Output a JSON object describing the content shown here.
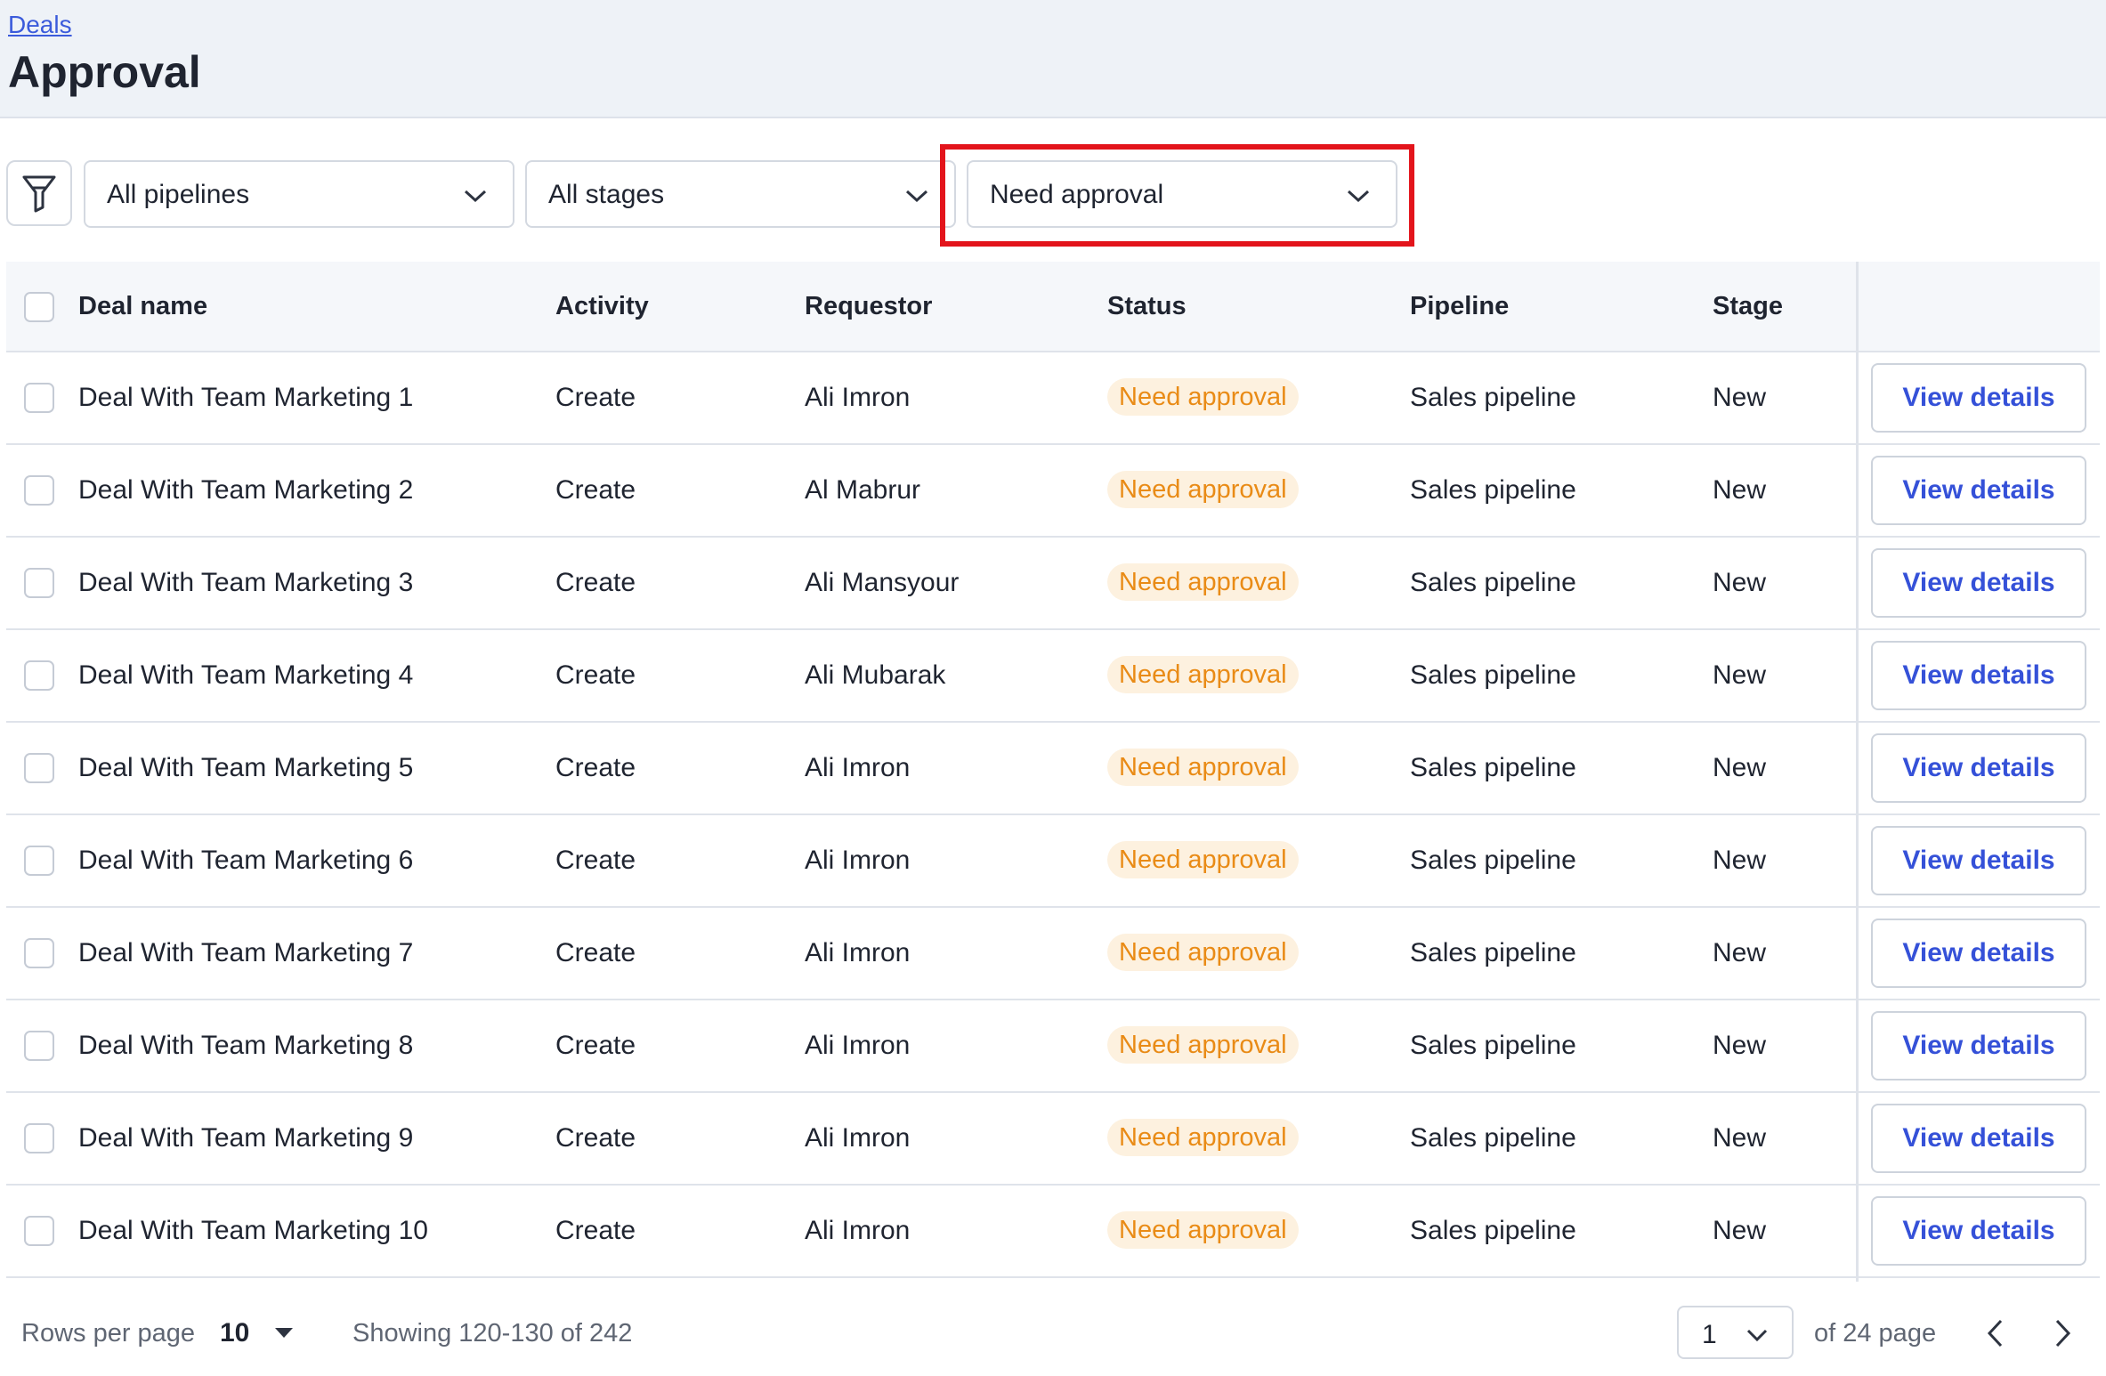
{
  "header": {
    "breadcrumb": "Deals",
    "title": "Approval"
  },
  "filters": {
    "filter_icon": "funnel-icon",
    "pipeline": "All pipelines",
    "stage": "All stages",
    "status": "Need approval"
  },
  "table": {
    "columns": {
      "deal_name": "Deal name",
      "activity": "Activity",
      "requestor": "Requestor",
      "status": "Status",
      "pipeline": "Pipeline",
      "stage": "Stage"
    },
    "rows": [
      {
        "deal_name": "Deal With Team Marketing 1",
        "activity": "Create",
        "requestor": "Ali Imron",
        "status": "Need approval",
        "pipeline": "Sales pipeline",
        "stage": "New",
        "action": "View details"
      },
      {
        "deal_name": "Deal With Team Marketing 2",
        "activity": "Create",
        "requestor": "Al Mabrur",
        "status": "Need approval",
        "pipeline": "Sales pipeline",
        "stage": "New",
        "action": "View details"
      },
      {
        "deal_name": "Deal With Team Marketing 3",
        "activity": "Create",
        "requestor": "Ali Mansyour",
        "status": "Need approval",
        "pipeline": "Sales pipeline",
        "stage": "New",
        "action": "View details"
      },
      {
        "deal_name": "Deal With Team Marketing 4",
        "activity": "Create",
        "requestor": "Ali Mubarak",
        "status": "Need approval",
        "pipeline": "Sales pipeline",
        "stage": "New",
        "action": "View details"
      },
      {
        "deal_name": "Deal With Team Marketing 5",
        "activity": "Create",
        "requestor": "Ali Imron",
        "status": "Need approval",
        "pipeline": "Sales pipeline",
        "stage": "New",
        "action": "View details"
      },
      {
        "deal_name": "Deal With Team Marketing 6",
        "activity": "Create",
        "requestor": "Ali Imron",
        "status": "Need approval",
        "pipeline": "Sales pipeline",
        "stage": "New",
        "action": "View details"
      },
      {
        "deal_name": "Deal With Team Marketing 7",
        "activity": "Create",
        "requestor": "Ali Imron",
        "status": "Need approval",
        "pipeline": "Sales pipeline",
        "stage": "New",
        "action": "View details"
      },
      {
        "deal_name": "Deal With Team Marketing 8",
        "activity": "Create",
        "requestor": "Ali Imron",
        "status": "Need approval",
        "pipeline": "Sales pipeline",
        "stage": "New",
        "action": "View details"
      },
      {
        "deal_name": "Deal With Team Marketing 9",
        "activity": "Create",
        "requestor": "Ali Imron",
        "status": "Need approval",
        "pipeline": "Sales pipeline",
        "stage": "New",
        "action": "View details"
      },
      {
        "deal_name": "Deal With Team Marketing 10",
        "activity": "Create",
        "requestor": "Ali Imron",
        "status": "Need approval",
        "pipeline": "Sales pipeline",
        "stage": "New",
        "action": "View details"
      }
    ]
  },
  "footer": {
    "rows_per_page_label": "Rows per page",
    "rows_per_page_value": "10",
    "showing": "Showing 120-130 of 242",
    "current_page": "1",
    "page_total": "of 24 page"
  },
  "colors": {
    "accent": "#3551d8",
    "status_text": "#e98b16",
    "status_bg": "#fdf1df",
    "highlight": "#e3141b"
  }
}
